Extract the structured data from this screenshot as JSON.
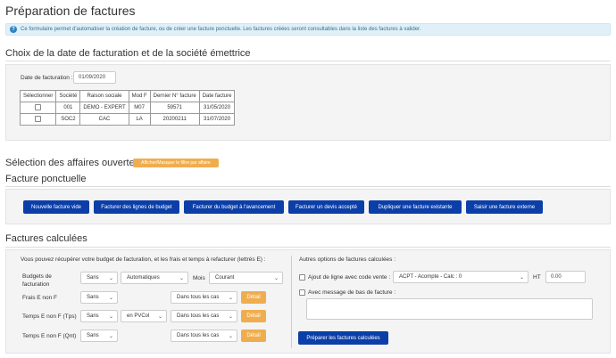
{
  "page": {
    "title": "Préparation de factures",
    "info_text": "Ce formulaire permet d'automatiser la création de facture, ou de créer une facture ponctuelle. Les factures créées seront consultables dans la liste des factures à valider."
  },
  "choix": {
    "heading": "Choix de la date de facturation et de la société émettrice",
    "date_label": "Date de facturation :",
    "date_value": "01/09/2020",
    "table": {
      "headers": [
        "Sélectionner",
        "Société",
        "Raison sociale",
        "Mod F",
        "Dernier N° facture",
        "Date facture"
      ],
      "rows": [
        [
          "",
          "001",
          "DEMO - EXPERT",
          "M07",
          "59571",
          "31/05/2020"
        ],
        [
          "",
          "SOC2",
          "CAC",
          "LA",
          "20200211",
          "31/07/2020"
        ]
      ]
    }
  },
  "affaires": {
    "heading": "Sélection des affaires ouvertes",
    "toggle_label": "Afficher/Masquer le filtre par affaire"
  },
  "ponctuelle": {
    "heading": "Facture ponctuelle",
    "buttons": [
      "Nouvelle facture vide",
      "Facturer des lignes de budget",
      "Facturer du budget à l'avancement",
      "Facturer un devis accepté",
      "Dupliquer une facture existante",
      "Saisir une facture externe"
    ]
  },
  "calculees": {
    "heading": "Factures calculées",
    "intro": "Vous pouvez récupérer votre budget de facturation, et les frais et temps à refacturer (lettrés E) :",
    "rows": {
      "budgets": {
        "label": "Budgets de facturation",
        "sel1": "Sans",
        "sel2": "Automatiques",
        "mois_label": "Mois",
        "sel3": "Courant"
      },
      "frais": {
        "label": "Frais E non F",
        "sel1": "Sans",
        "sel3": "Dans tous les cas",
        "detail": "Détail"
      },
      "temps_tps": {
        "label": "Temps E non F (Tps)",
        "sel1": "Sans",
        "sel2": "en PVCol",
        "sel3": "Dans tous les cas",
        "detail": "Détail"
      },
      "temps_qnt": {
        "label": "Temps E non F (Qnt)",
        "sel1": "Sans",
        "sel3": "Dans tous les cas",
        "detail": "Détail"
      }
    },
    "autres": {
      "title": "Autres options de factures calculées :",
      "ajout_label": "Ajout de ligne avec code vente :",
      "code_vente": "ACPT - Acompte - Calc : 0",
      "ht_label": "HT",
      "ht_value": "0.00",
      "message_label": "Avec message de bas de facture :",
      "submit": "Préparer les factures calculées"
    }
  }
}
